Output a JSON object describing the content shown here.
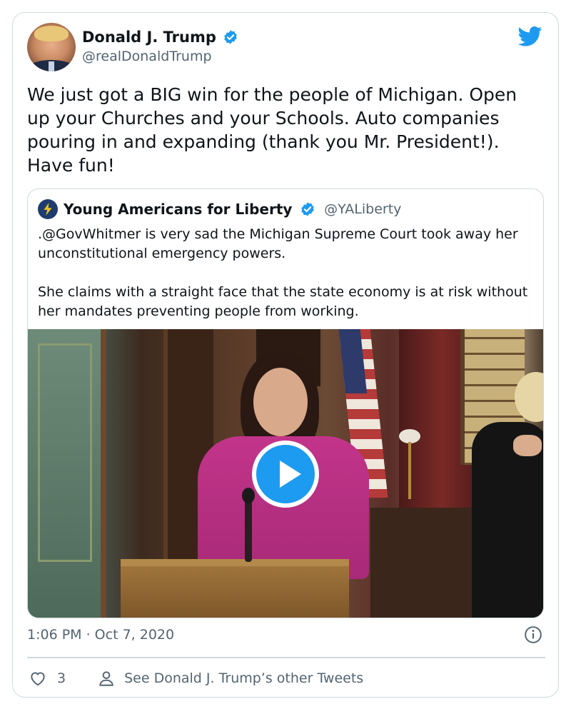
{
  "author": {
    "name": "Donald J. Trump",
    "handle": "@realDonaldTrump",
    "avatar_icon": "avatar-photo",
    "verified_icon": "verified-badge-icon"
  },
  "tweet": {
    "text": "We just got a BIG win for the people of Michigan. Open up your Churches and your Schools. Auto companies pouring in and expanding (thank you Mr. President!). Have fun!",
    "timestamp": "1:06 PM · Oct 7, 2020"
  },
  "quoted": {
    "name": "Young Americans for Liberty",
    "handle": "@YALiberty",
    "paragraphs": [
      ".@GovWhitmer is very sad the Michigan Supreme Court took away her unconstitutional emergency powers.",
      "She claims with a straight face that the state economy is at risk without her mandates preventing people from working."
    ],
    "media_icon": "play-button-icon"
  },
  "actions": {
    "like_count": "3",
    "profile_link": "See Donald J. Trump’s other Tweets"
  },
  "colors": {
    "accent": "#1d9bf0",
    "text": "#0f1419",
    "muted": "#536471",
    "border": "#cfd9de"
  }
}
